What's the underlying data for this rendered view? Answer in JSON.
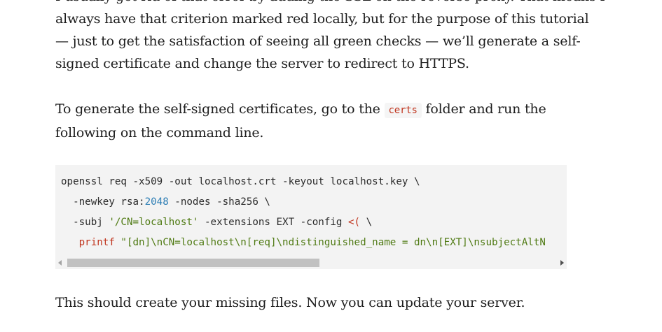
{
  "article": {
    "p1": {
      "line0": "I usually get rid of that error by adding the SSL on the reverse proxy. That means I",
      "line1": "always have that criterion marked red locally, but for the purpose of this tutorial",
      "line2": "— just to get the satisfaction of seeing all green checks — we’ll generate a self-",
      "line3": "signed certificate and change the server to redirect to HTTPS."
    },
    "p2": {
      "before_code": "To generate the self-signed certificates, go to the ",
      "inline_code": "certs",
      "after_code": " folder and run the",
      "line2": "following on the command line."
    },
    "p3": "This should create your missing files. Now you can update your server."
  },
  "code_block": {
    "line1": "openssl req -x509 -out localhost.crt -keyout localhost.key \\",
    "line2_a": "  -newkey rsa:",
    "line2_num": "2048",
    "line2_b": " -nodes -sha256 \\",
    "line3_a": "  -subj ",
    "line3_str": "'/CN=localhost'",
    "line3_b": " -extensions EXT -config ",
    "line3_punct": "<(",
    "line3_c": " \\",
    "line4_indent": "   ",
    "line4_kw": "printf",
    "line4_str": " \"[dn]\\nCN=localhost\\n[req]\\ndistinguished_name = dn\\n[EXT]\\nsubjectAltN"
  },
  "colors": {
    "text": "#1e1e1e",
    "inline_code": "#c0341d",
    "code_bg": "#f3f3f3",
    "code_number": "#2f7fb5",
    "code_string": "#4f7a13"
  }
}
